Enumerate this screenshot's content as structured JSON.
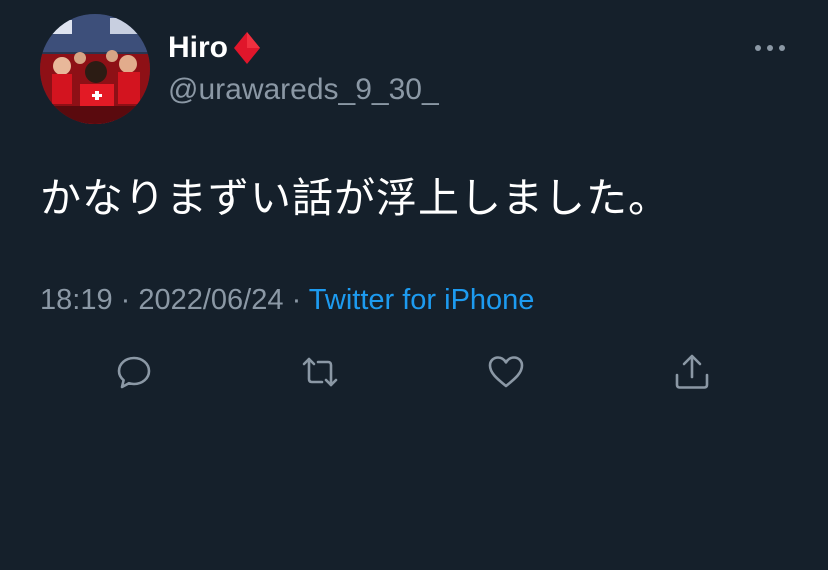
{
  "author": {
    "display_name": "Hiro",
    "handle": "@urawareds_9_30_",
    "badge_icon": "red-diamond-icon"
  },
  "tweet": {
    "text": "かなりまずい話が浮上しました。",
    "time": "18:19",
    "separator": " · ",
    "date": "2022/06/24",
    "source": "Twitter for iPhone"
  },
  "actions": [
    "reply-icon",
    "retweet-icon",
    "like-icon",
    "share-icon"
  ],
  "colors": {
    "background": "#15202b",
    "text": "#ffffff",
    "muted": "#8b98a5",
    "link": "#1d9bf0",
    "badge": "#e0162b"
  }
}
